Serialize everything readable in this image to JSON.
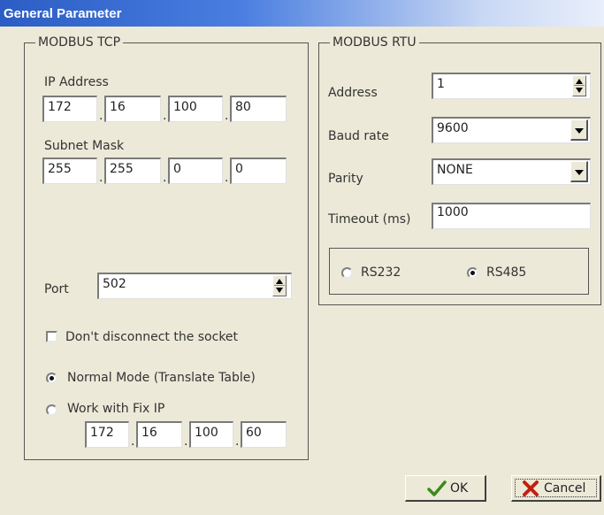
{
  "window": {
    "title": "General Parameter"
  },
  "tcp": {
    "legend": "MODBUS TCP",
    "ip_label": "IP Address",
    "ip": [
      "172",
      "16",
      "100",
      "80"
    ],
    "subnet_label": "Subnet Mask",
    "subnet": [
      "255",
      "255",
      "0",
      "0"
    ],
    "port_label": "Port",
    "port": "502",
    "dont_disconnect_label": "Don't disconnect the socket",
    "dont_disconnect_checked": false,
    "normal_mode_label": "Normal Mode (Translate Table)",
    "normal_mode_selected": true,
    "fix_ip_label": "Work with Fix IP",
    "fix_ip_selected": false,
    "fix_ip": [
      "172",
      "16",
      "100",
      "60"
    ]
  },
  "rtu": {
    "legend": "MODBUS RTU",
    "address_label": "Address",
    "address": "1",
    "baud_label": "Baud rate",
    "baud": "9600",
    "parity_label": "Parity",
    "parity": "NONE",
    "timeout_label": "Timeout (ms)",
    "timeout": "1000",
    "rs232_label": "RS232",
    "rs485_label": "RS485",
    "selected_interface": "RS485"
  },
  "buttons": {
    "ok": "OK",
    "cancel": "Cancel"
  },
  "icons": {
    "ok": "checkmark-icon",
    "cancel": "x-icon"
  },
  "colors": {
    "titlebar": "#2b5dc4",
    "ok_icon": "#3a8a1a",
    "cancel_icon": "#c02010",
    "dialog_bg": "#ece9d8"
  }
}
